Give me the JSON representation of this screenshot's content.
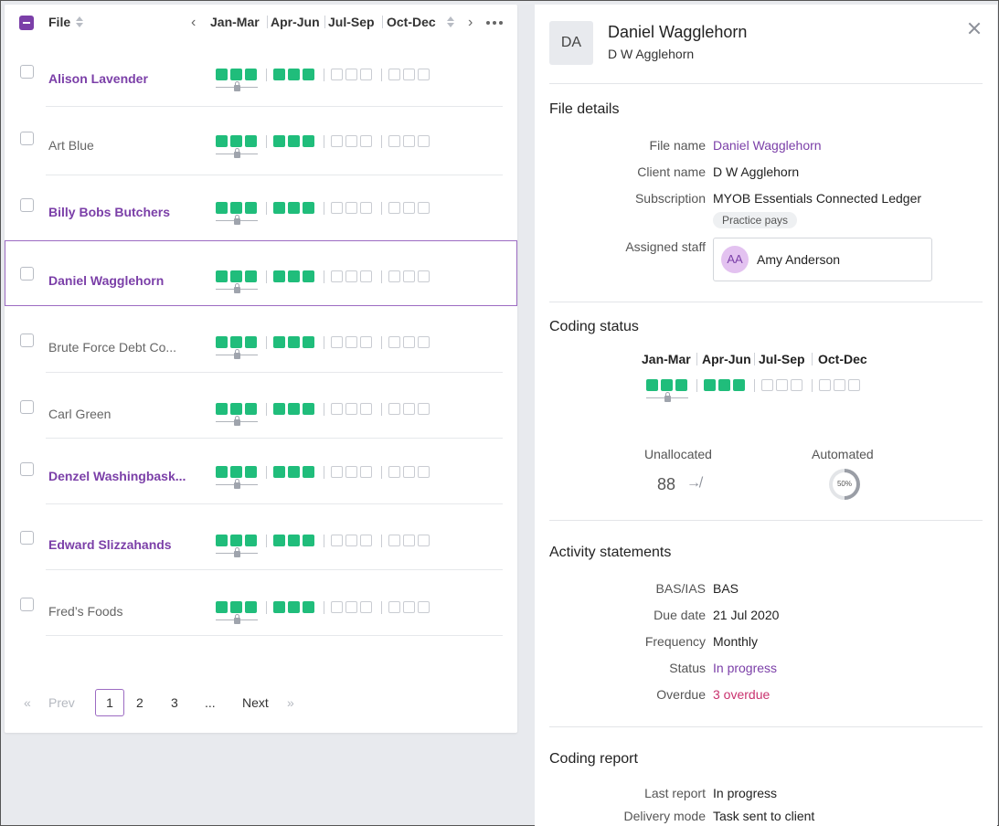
{
  "list": {
    "header": {
      "file_label": "File",
      "quarters": [
        "Jan-Mar",
        "Apr-Jun",
        "Jul-Sep",
        "Oct-Dec"
      ],
      "prev_icon": "chevron-left-icon",
      "next_icon": "chevron-right-icon",
      "more_icon": "more-horizontal-icon"
    },
    "rows": [
      {
        "name": "Alison Lavender",
        "style": "link",
        "selected": false,
        "quarters_done": [
          3,
          3,
          0,
          0
        ]
      },
      {
        "name": "Art Blue",
        "style": "plain",
        "selected": false,
        "quarters_done": [
          3,
          3,
          0,
          0
        ]
      },
      {
        "name": "Billy Bobs Butchers",
        "style": "link",
        "selected": false,
        "quarters_done": [
          3,
          3,
          0,
          0
        ]
      },
      {
        "name": "Daniel Wagglehorn",
        "style": "link",
        "selected": true,
        "quarters_done": [
          3,
          3,
          0,
          0
        ]
      },
      {
        "name": "Brute Force Debt Co...",
        "style": "plain",
        "selected": false,
        "quarters_done": [
          3,
          3,
          0,
          0
        ]
      },
      {
        "name": "Carl Green",
        "style": "plain",
        "selected": false,
        "quarters_done": [
          3,
          3,
          0,
          0
        ]
      },
      {
        "name": "Denzel Washingbask...",
        "style": "link",
        "selected": false,
        "quarters_done": [
          3,
          3,
          0,
          0
        ]
      },
      {
        "name": "Edward Slizzahands",
        "style": "link",
        "selected": false,
        "quarters_done": [
          3,
          3,
          0,
          0
        ]
      },
      {
        "name": "Fred’s Foods",
        "style": "plain",
        "selected": false,
        "quarters_done": [
          3,
          3,
          0,
          0
        ]
      }
    ],
    "pagination": {
      "first_icon": "«",
      "prev_label": "Prev",
      "pages": [
        "1",
        "2",
        "3",
        "..."
      ],
      "current_page": "1",
      "next_label": "Next",
      "last_icon": "»"
    }
  },
  "detail": {
    "avatar_initials": "DA",
    "title": "Daniel Wagglehorn",
    "subtitle": "D W Agglehorn",
    "close_icon": "close-icon",
    "file_details": {
      "title": "File details",
      "file_name_label": "File name",
      "file_name_value": "Daniel Wagglehorn",
      "client_name_label": "Client name",
      "client_name_value": "D W Agglehorn",
      "subscription_label": "Subscription",
      "subscription_value": "MYOB Essentials Connected Ledger",
      "subscription_pill": "Practice pays",
      "assigned_staff_label": "Assigned staff",
      "staff_initials": "AA",
      "staff_name": "Amy Anderson"
    },
    "coding_status": {
      "title": "Coding status",
      "quarters": [
        "Jan-Mar",
        "Apr-Jun",
        "Jul-Sep",
        "Oct-Dec"
      ],
      "quarters_done": [
        3,
        3,
        0,
        0
      ],
      "unallocated_label": "Unallocated",
      "unallocated_value": "88",
      "automated_label": "Automated",
      "automated_percent": 50,
      "automated_text": "50%"
    },
    "activity_statements": {
      "title": "Activity statements",
      "bas_label": "BAS/IAS",
      "bas_value": "BAS",
      "due_label": "Due date",
      "due_value": "21 Jul 2020",
      "frequency_label": "Frequency",
      "frequency_value": "Monthly",
      "status_label": "Status",
      "status_value": "In progress",
      "overdue_label": "Overdue",
      "overdue_value": "3 overdue"
    },
    "coding_report": {
      "title": "Coding report",
      "last_report_label": "Last report",
      "last_report_value": "In progress",
      "delivery_label": "Delivery mode",
      "delivery_value": "Task sent to client"
    }
  },
  "colors": {
    "accent_purple": "#7b3fa8",
    "done_green": "#20bd7b",
    "overdue_red": "#c9326e"
  }
}
